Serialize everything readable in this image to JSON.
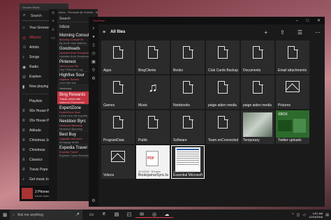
{
  "groove": {
    "title": "Groove Music",
    "search": "Search",
    "items": [
      {
        "label": "Your Groove",
        "icon": "home-icon",
        "glyph": "⌂"
      },
      {
        "label": "Albums",
        "icon": "album-icon",
        "glyph": "◎"
      },
      {
        "label": "Artists",
        "icon": "person-icon",
        "glyph": "☺"
      },
      {
        "label": "Songs",
        "icon": "note-icon",
        "glyph": "♪"
      },
      {
        "label": "Radio",
        "icon": "radio-icon",
        "glyph": "◉"
      },
      {
        "label": "Explore",
        "icon": "compass-icon",
        "glyph": "⊙"
      },
      {
        "label": "Now playing",
        "icon": "playing-icon",
        "glyph": "▮"
      },
      {
        "label": "Playlists",
        "icon": "playlist-icon",
        "glyph": ""
      },
      {
        "label": "90s House P",
        "icon": "playlist-icon",
        "glyph": "≡"
      },
      {
        "label": "20s House P",
        "icon": "playlist-icon",
        "glyph": "≡"
      },
      {
        "label": "Attitude",
        "icon": "playlist-icon",
        "glyph": "≡"
      },
      {
        "label": "Christmas Ja",
        "icon": "playlist-icon",
        "glyph": "≡"
      },
      {
        "label": "Christmas",
        "icon": "playlist-icon",
        "glyph": "≡"
      },
      {
        "label": "Classics",
        "icon": "playlist-icon",
        "glyph": "≡"
      },
      {
        "label": "Travis Pope",
        "icon": "playlist-icon",
        "glyph": "≡"
      },
      {
        "label": "Get music in",
        "icon": "store-icon",
        "glyph": "♪"
      }
    ],
    "now_playing": {
      "title": "2 Phones",
      "artist": "Kevin Gates"
    }
  },
  "mail": {
    "title": "Inbox - Personal @ Outlook - Mail",
    "search": "Search",
    "folder": "Inbox",
    "messages": [
      {
        "from": "Morning Consul",
        "subject": "Morning Consult Br",
        "preview": "By Anne Haw Nations"
      },
      {
        "from": "Goodreads",
        "subject": "Updates from Goodreads",
        "preview": "Updates from Goodreads"
      },
      {
        "from": "Pinterest",
        "subject": "Here's your Pin",
        "preview": "Hey Pinterest Lucy"
      },
      {
        "from": "Highfive Sour",
        "subject": "Highfive Source",
        "preview": "Don't like this"
      },
      {
        "group": "Yesterday"
      },
      {
        "from": "Bing Rewards",
        "subject": "Travis, never ask",
        "preview": "National Cheeseball",
        "selected": true
      },
      {
        "from": "ExpertZone",
        "subject": "ExpertZone Now",
        "preview": "Learn from the experts"
      },
      {
        "from": "Nextdoor Byrc",
        "subject": "Nextdoor Byrcamp",
        "preview": "Nextdoor Byrcamp"
      },
      {
        "from": "Best Buy",
        "subject": "Upgrade and save",
        "preview": "Mortgage deals"
      },
      {
        "from": "Expedia Travel",
        "subject": "Expedia Travel",
        "preview": "Expedia Travel Rewards"
      }
    ]
  },
  "onedrive": {
    "app_title": "OneDrive",
    "header": "All files",
    "tiles": [
      {
        "label": "Apps",
        "kind": "doc"
      },
      {
        "label": "BingClients",
        "kind": "doc"
      },
      {
        "label": "Books",
        "kind": "doc"
      },
      {
        "label": "Club Cards Backup",
        "kind": "doc"
      },
      {
        "label": "Documents",
        "kind": "doc"
      },
      {
        "label": "Email attachments",
        "kind": "doc"
      },
      {
        "label": "Games",
        "kind": "doc"
      },
      {
        "label": "Music",
        "kind": "music"
      },
      {
        "label": "Notebooks",
        "kind": "doc"
      },
      {
        "label": "paige aiden media",
        "kind": "doc"
      },
      {
        "label": "paige aiden media",
        "kind": "doc"
      },
      {
        "label": "Pictures",
        "kind": "pic"
      },
      {
        "label": "ProgramData",
        "kind": "doc"
      },
      {
        "label": "Public",
        "kind": "doc"
      },
      {
        "label": "Software",
        "kind": "doc"
      },
      {
        "label": "Team enConnected",
        "kind": "doc"
      },
      {
        "label": "Temporary",
        "kind": "shot"
      },
      {
        "label": "Twitter uploads",
        "kind": "xbox"
      },
      {
        "label": "Videos",
        "kind": "pic"
      },
      {
        "label": "BooksjamarSync.bsp",
        "sub": "3/13/2016 · 80 bytes",
        "kind": "pdf"
      },
      {
        "label": "Essential Microsoft Sc",
        "sub": "3/13/2016 · 300 KB",
        "kind": "paper"
      }
    ]
  },
  "taskbar": {
    "search_placeholder": "Ask me anything",
    "time": "4:51 AM",
    "date": "12/13/2016"
  }
}
